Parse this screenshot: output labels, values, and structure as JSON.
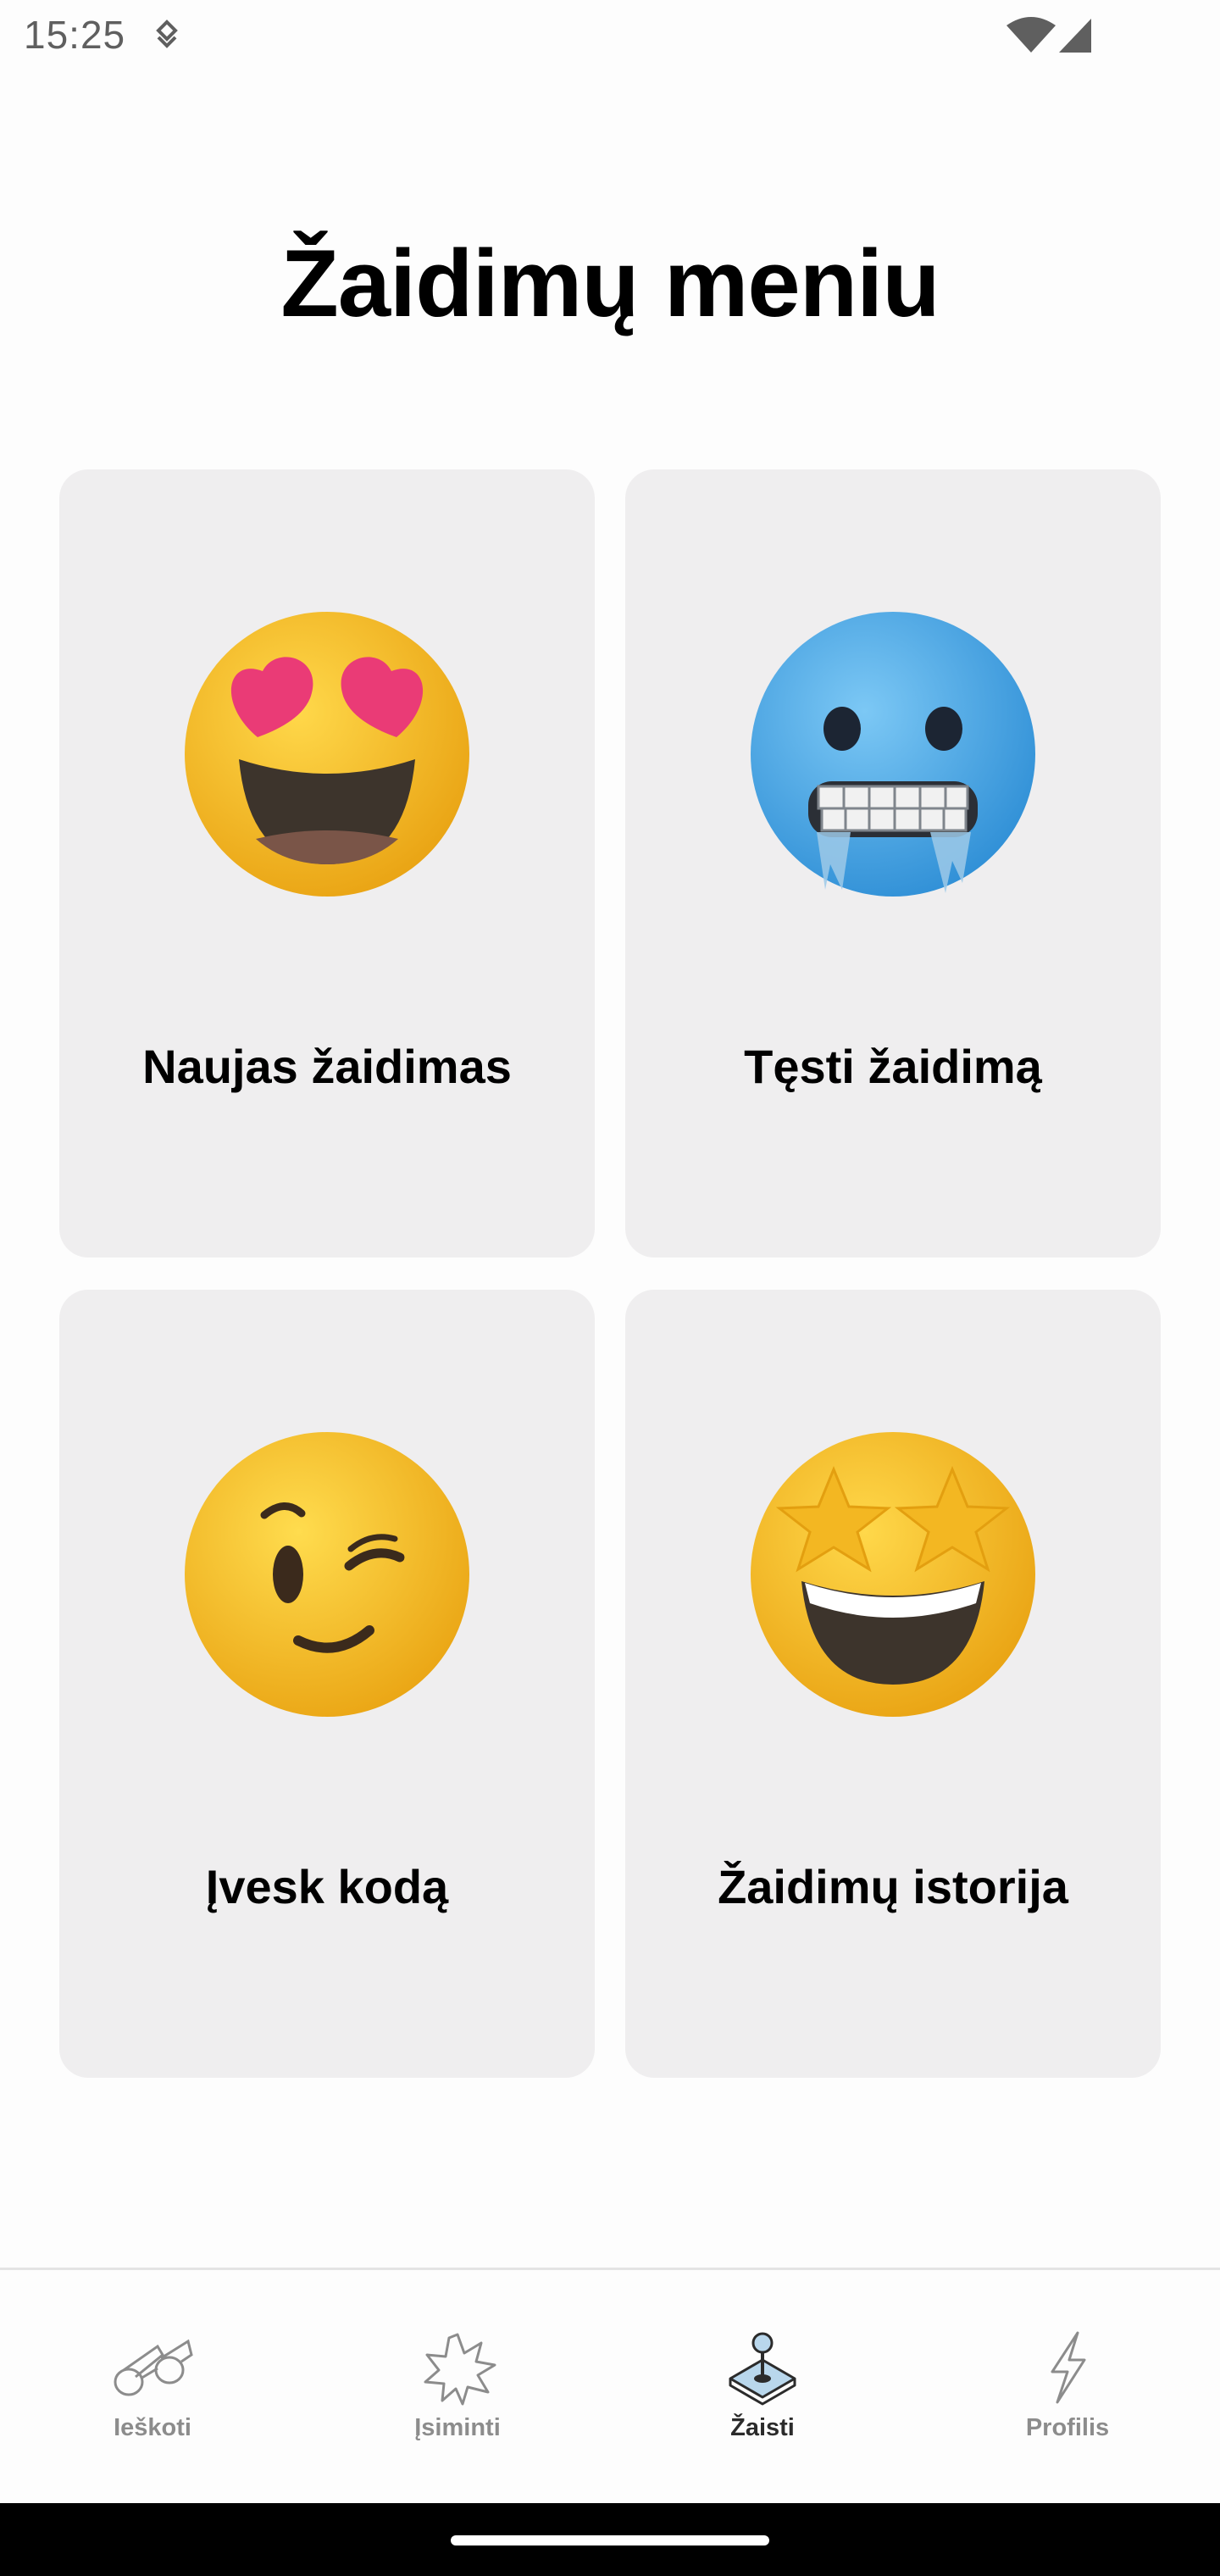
{
  "status_bar": {
    "time": "15:25"
  },
  "page": {
    "title": "Žaidimų meniu"
  },
  "cards": [
    {
      "label": "Naujas žaidimas",
      "icon": "heart-eyes-emoji-icon"
    },
    {
      "label": "Tęsti žaidimą",
      "icon": "cold-face-emoji-icon"
    },
    {
      "label": "Įvesk kodą",
      "icon": "winking-face-emoji-icon"
    },
    {
      "label": "Žaidimų istorija",
      "icon": "star-struck-emoji-icon"
    }
  ],
  "bottom_nav": {
    "items": [
      {
        "label": "Ieškoti",
        "icon": "binoculars-icon",
        "active": false
      },
      {
        "label": "Įsiminti",
        "icon": "starburst-icon",
        "active": false
      },
      {
        "label": "Žaisti",
        "icon": "joystick-icon",
        "active": true
      },
      {
        "label": "Profilis",
        "icon": "lightning-icon",
        "active": false
      }
    ]
  },
  "colors": {
    "background": "#fdfdfd",
    "card_background": "#efeeef",
    "emoji_yellow": "#f5b82a",
    "emoji_blue": "#4aa6e6",
    "nav_active": "#2b2b2b",
    "nav_inactive": "#8c8c8c"
  }
}
